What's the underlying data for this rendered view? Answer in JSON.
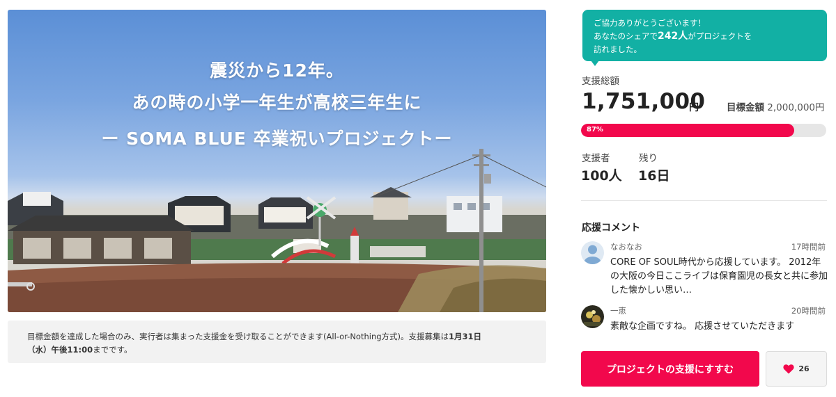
{
  "hero": {
    "line1": "震災から12年。",
    "line2": "あの時の小学一年生が高校三年生に",
    "line3": "ー SOMA BLUE 卒業祝いプロジェクトー"
  },
  "notice": {
    "text_before": "目標金額を達成した場合のみ、実行者は集まった支援金を受け取ることができます(All-or-Nothing方式)。支援募集は",
    "deadline_date": "1月31日",
    "deadline_rest": "（水）午後11:00",
    "text_after": "までです。"
  },
  "share": {
    "line1": "ご協力ありがとうございます！",
    "line2_prefix": "あなたのシェアで",
    "count": "242人",
    "line2_suffix": "がプロジェクトを",
    "line3": "訪れました。"
  },
  "funding": {
    "total_label": "支援総額",
    "total_amount": "1,751,000",
    "currency": "円",
    "goal_label": "目標金額",
    "goal_amount": "2,000,000円",
    "progress_percent": 87,
    "progress_label": "87%"
  },
  "stats": {
    "supporters_label": "支援者",
    "supporters_value": "100人",
    "remaining_label": "残り",
    "remaining_value": "16日"
  },
  "comments": {
    "title": "応援コメント",
    "items": [
      {
        "name": "なおなお",
        "time": "17時間前",
        "text": "CORE OF SOUL時代から応援しています。 2012年の大阪の今日ここライブは保育園児の長女と共に参加した懐かしい思い…"
      },
      {
        "name": "一恵",
        "time": "20時間前",
        "text": "素敵な企画ですね。 応援させていただきます"
      }
    ]
  },
  "actions": {
    "support_label": "プロジェクトの支援にすすむ",
    "like_count": "26"
  },
  "colors": {
    "accent": "#f2084c",
    "share_bg": "#12b0a4"
  },
  "icons": {
    "like": "heart-icon",
    "default_avatar": "user-avatar-icon"
  }
}
